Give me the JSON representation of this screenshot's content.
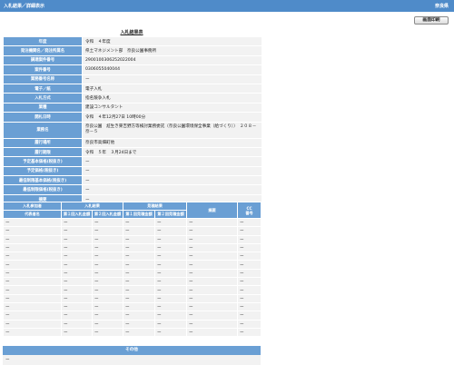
{
  "window": {
    "title": "入札結果／詳細表示",
    "user": "奈良県"
  },
  "toolbar": {
    "print_label": "画面印刷"
  },
  "section_title": "入札結果表",
  "details": [
    {
      "label": "年度",
      "value": "令和　４年度"
    },
    {
      "label": "発注機関名／発注所属名",
      "value": "県土マネジメント部　奈良公園事務所"
    },
    {
      "label": "調達案件番号",
      "value": "2900100306252022004"
    },
    {
      "label": "案件番号",
      "value": "0306055040044"
    },
    {
      "label": "業務番号名称",
      "value": "ー"
    },
    {
      "label": "電子／紙",
      "value": "電子入札"
    },
    {
      "label": "入札方式",
      "value": "指名競争入札"
    },
    {
      "label": "業種",
      "value": "建設コンサルタント"
    },
    {
      "label": "開札日時",
      "value": "令和　４年12月27日 10時00分"
    },
    {
      "label": "業務名",
      "value": "奈良公園　㍽生き東吉野方等検討業務委託（奈良公園環境保全事業（給づくり））　２０８－奈－５"
    },
    {
      "label": "履行場所",
      "value": "奈良市高畑町他"
    },
    {
      "label": "履行期限",
      "value": "令和　５年　３月24日まで"
    },
    {
      "label": "予定基本価格(税抜き)",
      "value": "ー"
    },
    {
      "label": "予定価格(税抜き)",
      "value": "ー"
    },
    {
      "label": "最低制限基本価格(税抜き)",
      "value": "ー"
    },
    {
      "label": "最低制限価格(税抜き)",
      "value": "ー"
    },
    {
      "label": "摘要",
      "value": "ー"
    }
  ],
  "bid_table": {
    "group_headers": [
      "入札参加者",
      "入札結果",
      "見積結果",
      "摘要",
      "CC\n番号"
    ],
    "sub_headers": [
      "代表者名",
      "第１回入札金額",
      "第２回入札金額",
      "第１回見積金額",
      "第２回見積金額"
    ],
    "rows": [
      [
        "ー",
        "ー",
        "ー",
        "ー",
        "ー",
        "ー",
        "ー"
      ],
      [
        "ー",
        "ー",
        "ー",
        "ー",
        "ー",
        "ー",
        "ー"
      ],
      [
        "ー",
        "ー",
        "ー",
        "ー",
        "ー",
        "ー",
        "ー"
      ],
      [
        "ー",
        "ー",
        "ー",
        "ー",
        "ー",
        "ー",
        "ー"
      ],
      [
        "ー",
        "ー",
        "ー",
        "ー",
        "ー",
        "ー",
        "ー"
      ],
      [
        "ー",
        "ー",
        "ー",
        "ー",
        "ー",
        "ー",
        "ー"
      ],
      [
        "ー",
        "ー",
        "ー",
        "ー",
        "ー",
        "ー",
        "ー"
      ],
      [
        "ー",
        "ー",
        "ー",
        "ー",
        "ー",
        "ー",
        "ー"
      ],
      [
        "ー",
        "ー",
        "ー",
        "ー",
        "ー",
        "ー",
        "ー"
      ],
      [
        "ー",
        "ー",
        "ー",
        "ー",
        "ー",
        "ー",
        "ー"
      ],
      [
        "ー",
        "ー",
        "ー",
        "ー",
        "ー",
        "ー",
        "ー"
      ],
      [
        "ー",
        "ー",
        "ー",
        "ー",
        "ー",
        "ー",
        "ー"
      ],
      [
        "ー",
        "ー",
        "ー",
        "ー",
        "ー",
        "ー",
        "ー"
      ],
      [
        "ー",
        "ー",
        "ー",
        "ー",
        "ー",
        "ー",
        "ー"
      ]
    ]
  },
  "other": {
    "heading": "その他",
    "value": "ー"
  },
  "colors": {
    "title_bar": "#4f8bc9",
    "header_cell": "#6a9fd4",
    "data_cell": "#f2f2f2"
  }
}
